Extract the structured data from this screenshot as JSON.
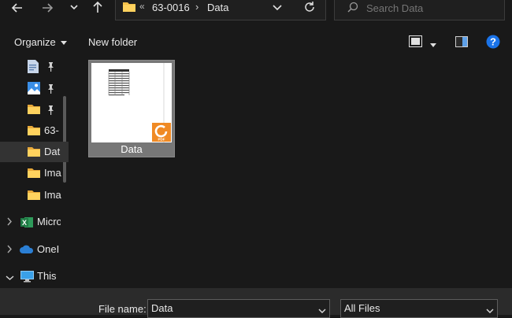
{
  "nav": {
    "back_icon": "arrow-left-icon",
    "forward_icon": "arrow-right-icon",
    "recent_icon": "chevron-down-icon",
    "up_icon": "arrow-up-icon"
  },
  "address": {
    "overflow": "«",
    "crumbs": [
      "63-0016",
      "Data"
    ],
    "separator": "›"
  },
  "search": {
    "placeholder": "Search Data"
  },
  "toolbar": {
    "organize_label": "Organize",
    "new_folder_label": "New folder"
  },
  "sidebar": {
    "quick_access": [
      {
        "icon": "document-icon",
        "label": "",
        "pinned": true
      },
      {
        "icon": "pictures-icon",
        "label": "",
        "pinned": true
      },
      {
        "icon": "folder-icon",
        "label": "",
        "pinned": true
      },
      {
        "icon": "folder-icon",
        "label": "63-",
        "pinned": false
      },
      {
        "icon": "folder-icon",
        "label": "Dat",
        "pinned": false,
        "selected": true
      },
      {
        "icon": "folder-icon",
        "label": "Ima",
        "pinned": false
      },
      {
        "icon": "folder-icon",
        "label": "Ima",
        "pinned": false
      }
    ],
    "roots": [
      {
        "icon": "excel-icon",
        "label": "Micro",
        "expanded": false
      },
      {
        "icon": "onedrive-icon",
        "label": "OneI",
        "expanded": false
      },
      {
        "icon": "monitor-icon",
        "label": "This",
        "expanded": true
      }
    ]
  },
  "files": [
    {
      "name": "Data",
      "type": "pdf",
      "badge": "PDF"
    }
  ],
  "bottom": {
    "file_name_label": "File name:",
    "file_name_value": "Data",
    "filter_value": "All Files"
  },
  "colors": {
    "accent": "#1a73e8",
    "folder": "#f4c04a",
    "pdf_badge": "#f08a24",
    "excel": "#1f7a44",
    "onedrive": "#2b7fd4"
  }
}
